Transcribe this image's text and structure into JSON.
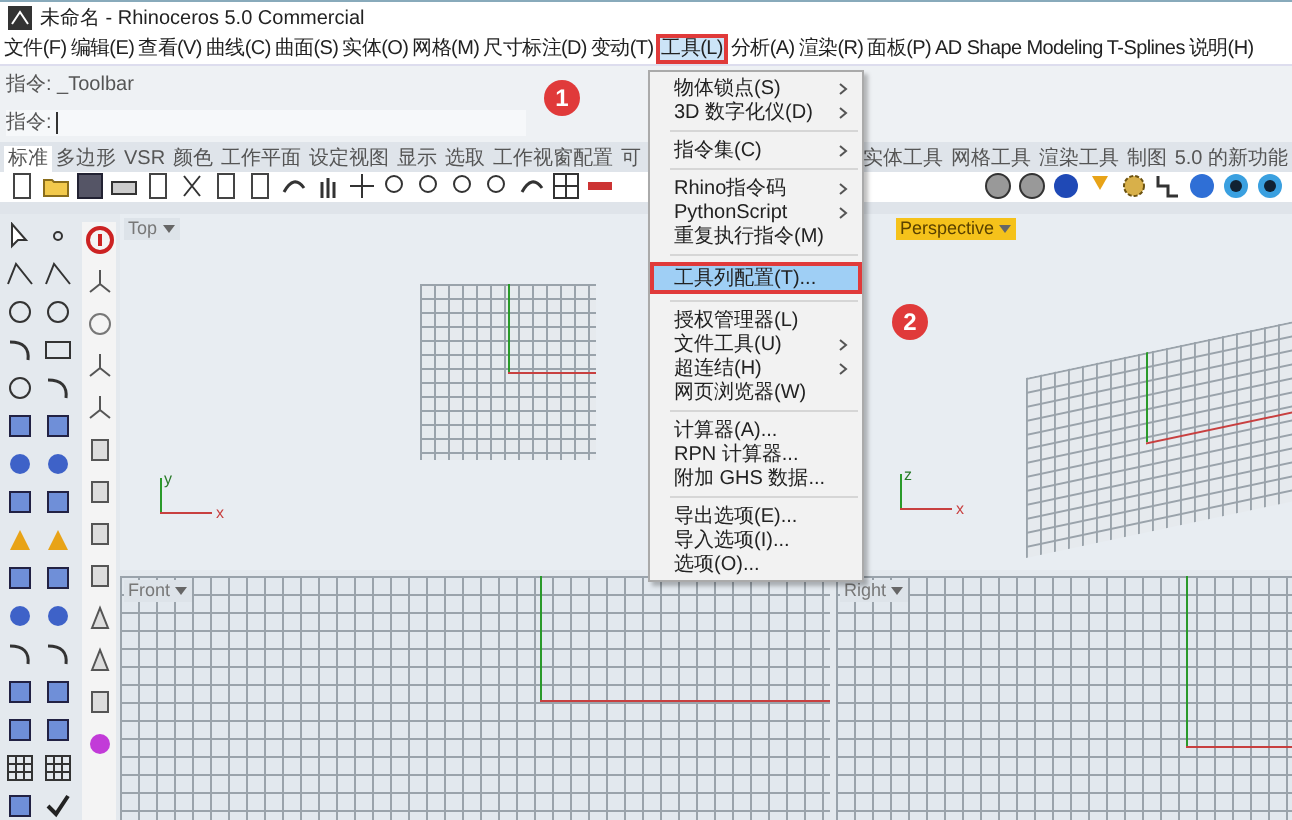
{
  "window": {
    "title": "未命名 - Rhinoceros 5.0 Commercial"
  },
  "menubar": [
    {
      "label": "文件(F)",
      "selected": false
    },
    {
      "label": "编辑(E)",
      "selected": false
    },
    {
      "label": "查看(V)",
      "selected": false
    },
    {
      "label": "曲线(C)",
      "selected": false
    },
    {
      "label": "曲面(S)",
      "selected": false
    },
    {
      "label": "实体(O)",
      "selected": false
    },
    {
      "label": "网格(M)",
      "selected": false
    },
    {
      "label": "尺寸标注(D)",
      "selected": false
    },
    {
      "label": "变动(T)",
      "selected": false
    },
    {
      "label": "工具(L)",
      "selected": true
    },
    {
      "label": "分析(A)",
      "selected": false
    },
    {
      "label": "渲染(R)",
      "selected": false
    },
    {
      "label": "面板(P)",
      "selected": false
    },
    {
      "label": "AD Shape Modeling",
      "selected": false
    },
    {
      "label": "T-Splines",
      "selected": false
    },
    {
      "label": "说明(H)",
      "selected": false
    }
  ],
  "command": {
    "history": "指令: _Toolbar",
    "prompt": "指令:"
  },
  "tabs_left": [
    {
      "label": "标准",
      "selected": true
    },
    {
      "label": "多边形",
      "selected": false
    },
    {
      "label": "VSR",
      "selected": false
    },
    {
      "label": "颜色",
      "selected": false
    },
    {
      "label": "工作平面",
      "selected": false
    },
    {
      "label": "设定视图",
      "selected": false
    },
    {
      "label": "显示",
      "selected": false
    },
    {
      "label": "选取",
      "selected": false
    },
    {
      "label": "工作视窗配置",
      "selected": false
    },
    {
      "label": "可",
      "selected": false
    }
  ],
  "tabs_right": [
    {
      "label": "实体工具",
      "selected": false
    },
    {
      "label": "网格工具",
      "selected": false
    },
    {
      "label": "渲染工具",
      "selected": false
    },
    {
      "label": "制图",
      "selected": false
    },
    {
      "label": "5.0 的新功能",
      "selected": false
    }
  ],
  "viewports": [
    {
      "label": "Top",
      "active": false,
      "axes": [
        "y",
        "x"
      ]
    },
    {
      "label": "Perspective",
      "active": true,
      "axes": [
        "z",
        "x"
      ]
    },
    {
      "label": "Front",
      "active": false
    },
    {
      "label": "Right",
      "active": false
    }
  ],
  "menu": [
    {
      "kind": "item",
      "label": "物体锁点(S)",
      "submenu": true,
      "selected": false
    },
    {
      "kind": "item",
      "label": "3D 数字化仪(D)",
      "submenu": true,
      "selected": false
    },
    {
      "kind": "separator"
    },
    {
      "kind": "item",
      "label": "指令集(C)",
      "submenu": true,
      "selected": false
    },
    {
      "kind": "separator"
    },
    {
      "kind": "item",
      "label": "Rhino指令码",
      "submenu": true,
      "selected": false
    },
    {
      "kind": "item",
      "label": "PythonScript",
      "submenu": true,
      "selected": false
    },
    {
      "kind": "item",
      "label": "重复执行指令(M)",
      "submenu": false,
      "selected": false
    },
    {
      "kind": "separator"
    },
    {
      "kind": "item",
      "label": "工具列配置(T)...",
      "submenu": false,
      "selected": true
    },
    {
      "kind": "separator"
    },
    {
      "kind": "item",
      "label": "授权管理器(L)",
      "submenu": false,
      "selected": false
    },
    {
      "kind": "item",
      "label": "文件工具(U)",
      "submenu": true,
      "selected": false
    },
    {
      "kind": "item",
      "label": "超连结(H)",
      "submenu": true,
      "selected": false
    },
    {
      "kind": "item",
      "label": "网页浏览器(W)",
      "submenu": false,
      "selected": false
    },
    {
      "kind": "separator"
    },
    {
      "kind": "item",
      "label": "计算器(A)...",
      "submenu": false,
      "selected": false
    },
    {
      "kind": "item",
      "label": "RPN 计算器...",
      "submenu": false,
      "selected": false
    },
    {
      "kind": "item",
      "label": "附加 GHS 数据...",
      "submenu": false,
      "selected": false
    },
    {
      "kind": "separator"
    },
    {
      "kind": "item",
      "label": "导出选项(E)...",
      "submenu": false,
      "selected": false
    },
    {
      "kind": "item",
      "label": "导入选项(I)...",
      "submenu": false,
      "selected": false
    },
    {
      "kind": "item",
      "label": "选项(O)...",
      "submenu": false,
      "selected": false
    }
  ],
  "callouts": [
    "1",
    "2"
  ]
}
